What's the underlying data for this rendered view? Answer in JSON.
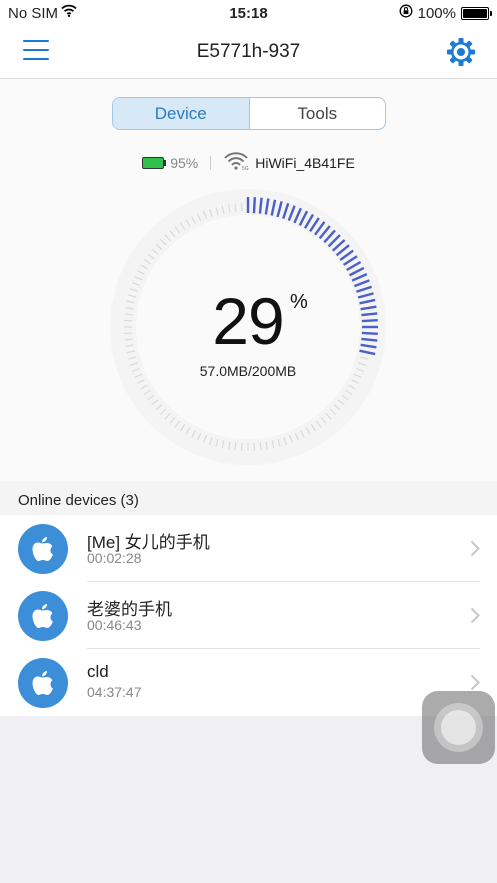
{
  "status_bar": {
    "carrier": "No SIM",
    "time": "15:18",
    "battery_pct": "100%",
    "battery_level": 1.0
  },
  "nav": {
    "title": "E5771h-937",
    "menu_icon": "hamburger-menu-icon",
    "settings_icon": "gear-icon"
  },
  "tabs": [
    {
      "label": "Device",
      "active": true
    },
    {
      "label": "Tools",
      "active": false
    }
  ],
  "info": {
    "battery_pct": "95%",
    "ssid": "HiWiFi_4B41FE"
  },
  "usage": {
    "percent": "29",
    "percent_sign": "%",
    "detail": "57.0MB/200MB",
    "fraction": 0.29
  },
  "devices": {
    "header": "Online devices (3)",
    "items": [
      {
        "name": "[Me] 女儿的手机",
        "time": "00:02:28",
        "icon": "apple-icon"
      },
      {
        "name": "老婆的手机",
        "time": "00:46:43",
        "icon": "apple-icon"
      },
      {
        "name": "cld",
        "time": "04:37:47",
        "icon": "apple-icon"
      }
    ]
  },
  "colors": {
    "accent": "#1b7ad3",
    "gauge_active": "#4a5fc7",
    "gauge_inactive": "#d9d9d9",
    "avatar": "#3d8ed8"
  }
}
